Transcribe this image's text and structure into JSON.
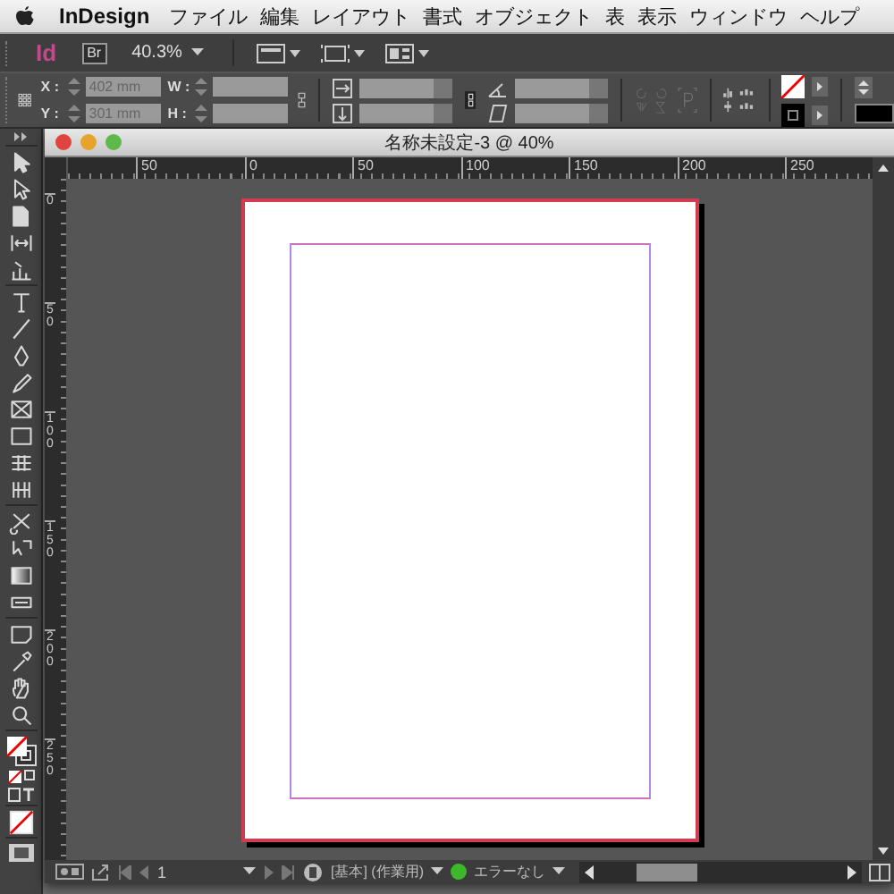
{
  "menu_bar": {
    "app_name": "InDesign",
    "items": [
      "ファイル",
      "編集",
      "レイアウト",
      "書式",
      "オブジェクト",
      "表",
      "表示",
      "ウィンドウ",
      "ヘルプ"
    ]
  },
  "app_bar": {
    "logo": "Id",
    "bridge": "Br",
    "zoom": "40.3%"
  },
  "control_panel": {
    "fields": [
      {
        "label": "X :",
        "value": "402 mm"
      },
      {
        "label": "Y :",
        "value": "301 mm"
      },
      {
        "label": "W :"
      },
      {
        "label": "H :"
      }
    ]
  },
  "document": {
    "title": "名称未設定-3 @ 40%",
    "h_ruler": [
      "50",
      "0",
      "50",
      "100",
      "150",
      "200",
      "250"
    ],
    "v_ruler": [
      "0",
      "50",
      "100",
      "150",
      "200",
      "250"
    ],
    "status": {
      "page": "1",
      "master": "[基本] (作業用)",
      "preflight": "エラーなし"
    }
  }
}
